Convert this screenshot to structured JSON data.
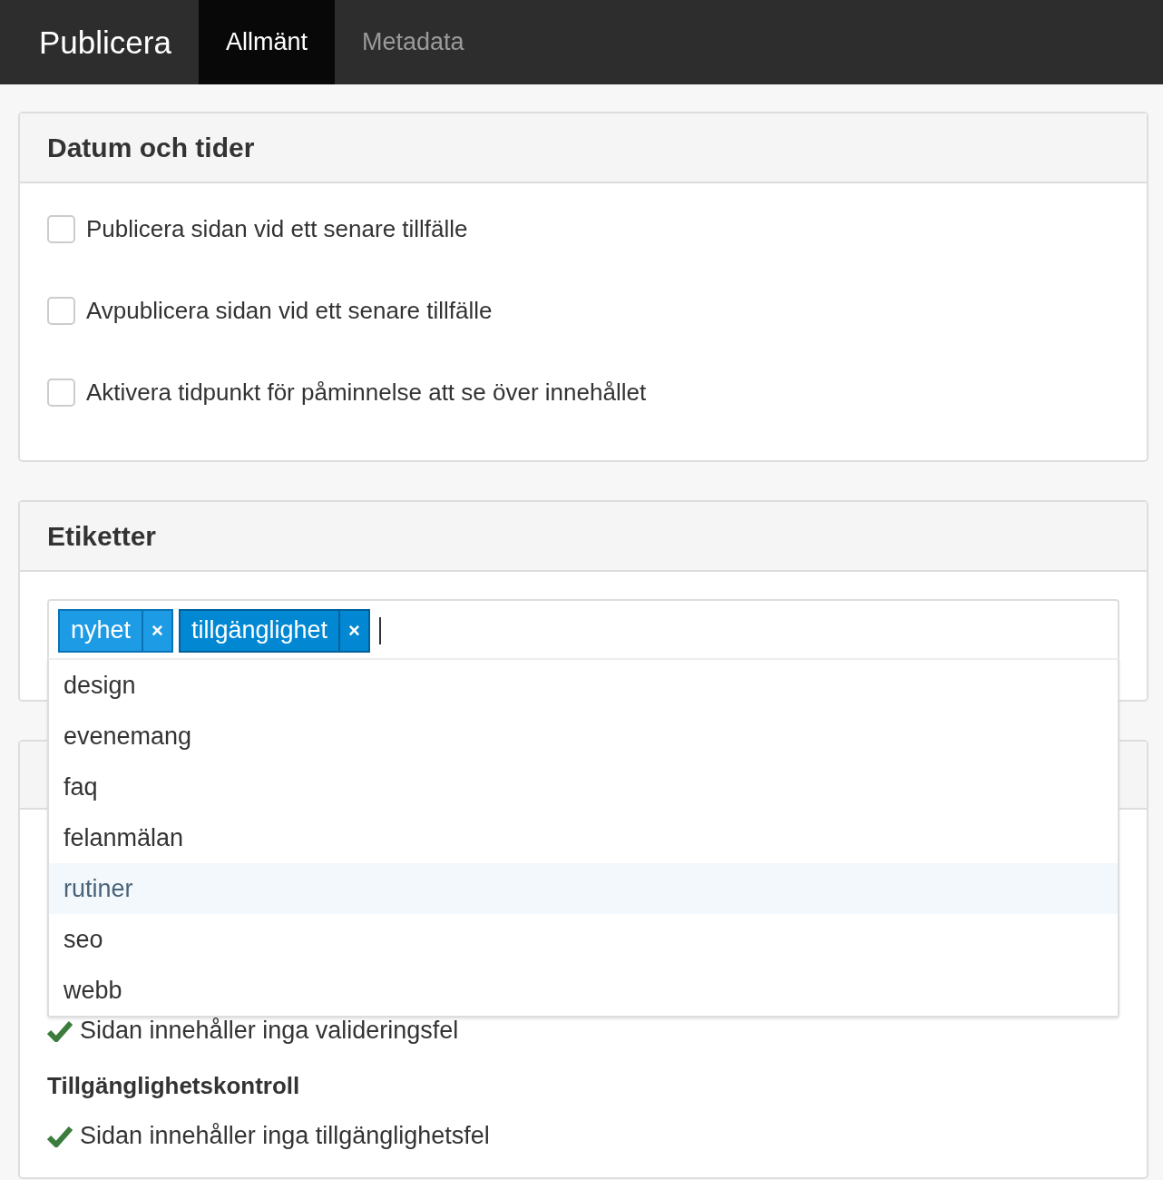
{
  "nav": {
    "brand": "Publicera",
    "tabs": [
      {
        "label": "Allmänt",
        "selected": true
      },
      {
        "label": "Metadata",
        "selected": false
      }
    ]
  },
  "dates_panel": {
    "title": "Datum och tider",
    "options": [
      {
        "label": "Publicera sidan vid ett senare tillfälle",
        "checked": false
      },
      {
        "label": "Avpublicera sidan vid ett senare tillfälle",
        "checked": false
      },
      {
        "label": "Aktivera tidpunkt för påminnelse att se över innehållet",
        "checked": false
      }
    ]
  },
  "tags_panel": {
    "title": "Etiketter",
    "tags": [
      {
        "label": "nyhet",
        "remove": "×",
        "selected": false
      },
      {
        "label": "tillgänglighet",
        "remove": "×",
        "selected": true
      }
    ],
    "suggestions": [
      {
        "label": "design",
        "selected": false
      },
      {
        "label": "evenemang",
        "selected": false
      },
      {
        "label": "faq",
        "selected": false
      },
      {
        "label": "felanmälan",
        "selected": false
      },
      {
        "label": "rutiner",
        "selected": true
      },
      {
        "label": "seo",
        "selected": false
      },
      {
        "label": "webb",
        "selected": false
      }
    ]
  },
  "checks_panel": {
    "validation": {
      "message": "Sidan innehåller inga valideringsfel",
      "passed": true
    },
    "accessibility": {
      "title": "Tillgänglighetskontroll",
      "message": "Sidan innehåller inga tillgänglighetsfel",
      "passed": true
    }
  }
}
